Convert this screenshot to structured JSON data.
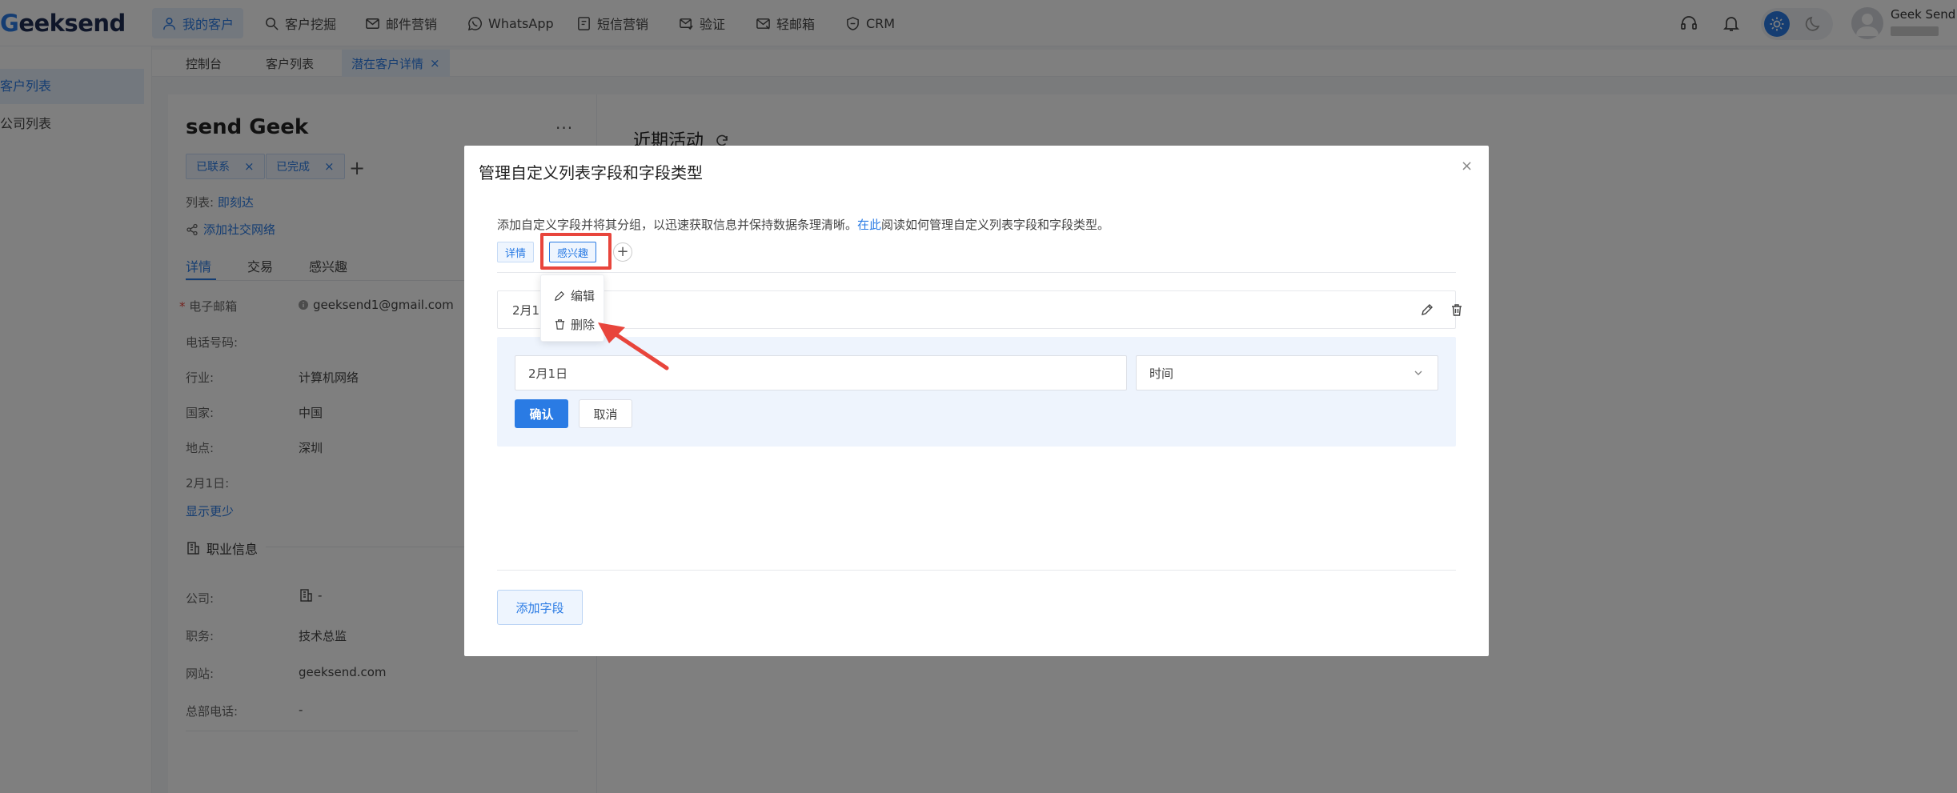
{
  "app": {
    "logo_prefix": "G",
    "logo_rest": "eeksend"
  },
  "nav": [
    {
      "label": "我的客户",
      "icon": "user-icon"
    },
    {
      "label": "客户挖掘",
      "icon": "search-icon"
    },
    {
      "label": "邮件营销",
      "icon": "mail-icon"
    },
    {
      "label": "WhatsApp",
      "icon": "whatsapp-icon"
    },
    {
      "label": "短信营销",
      "icon": "sms-icon"
    },
    {
      "label": "验证",
      "icon": "verify-mail-icon"
    },
    {
      "label": "轻邮箱",
      "icon": "light-mail-icon"
    },
    {
      "label": "CRM",
      "icon": "crm-icon"
    }
  ],
  "user": {
    "name": "Geek Send"
  },
  "tabs": [
    {
      "label": "控制台"
    },
    {
      "label": "客户列表"
    },
    {
      "label": "潜在客户详情",
      "close": "×"
    }
  ],
  "sidebar": {
    "items": [
      {
        "label": "客户列表"
      },
      {
        "label": "公司列表"
      }
    ]
  },
  "contact": {
    "name": "send Geek",
    "more": "···",
    "tags": [
      {
        "label": "已联系",
        "close": "×"
      },
      {
        "label": "已完成",
        "close": "×"
      }
    ],
    "add_tag": "+",
    "list_label": "列表:",
    "list_value": "即刻达",
    "add_social": "添加社交网络",
    "subtabs": [
      "详情",
      "交易",
      "感兴趣"
    ],
    "fields": [
      {
        "label": "电子邮箱",
        "value": "geeksend1@gmail.com",
        "required": "*"
      },
      {
        "label": "电话号码:",
        "value": ""
      },
      {
        "label": "行业:",
        "value": "计算机网络"
      },
      {
        "label": "国家:",
        "value": "中国"
      },
      {
        "label": "地点:",
        "value": "深圳"
      },
      {
        "label": "2月1日:",
        "value": ""
      }
    ],
    "show_less": "显示更少",
    "section_title": "职业信息",
    "job_fields": [
      {
        "label": "公司:",
        "value": "-"
      },
      {
        "label": "职务:",
        "value": "技术总监"
      },
      {
        "label": "网站:",
        "value": "geeksend.com"
      },
      {
        "label": "总部电话:",
        "value": "-"
      }
    ]
  },
  "recent": {
    "title": "近期活动"
  },
  "modal": {
    "title": "管理自定义列表字段和字段类型",
    "close": "×",
    "desc_prefix": "添加自定义字段并将其分组，以迅速获取信息并保持数据条理清晰。",
    "desc_link": "在此",
    "desc_suffix": "阅读如何管理自定义列表字段和字段类型。",
    "groups": [
      {
        "label": "详情"
      },
      {
        "label": "感兴趣"
      }
    ],
    "add_group": "+",
    "field_row_label": "2月1",
    "input_value": "2月1日",
    "select_value": "时间",
    "confirm": "确认",
    "cancel": "取消",
    "add_field": "添加字段"
  },
  "context_menu": {
    "items": [
      {
        "label": "编辑",
        "icon": "pencil-icon"
      },
      {
        "label": "删除",
        "icon": "trash-icon"
      }
    ]
  },
  "colors": {
    "accent": "#2a7be4",
    "highlight_box": "#e8453c",
    "overlay": "rgba(0,0,0,0.5)"
  }
}
